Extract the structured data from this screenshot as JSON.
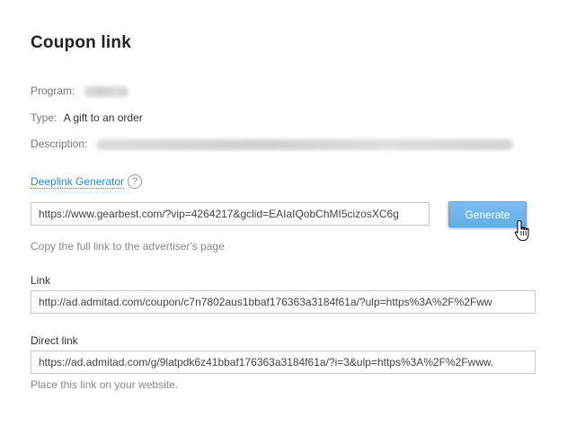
{
  "title": "Coupon link",
  "info": {
    "program_label": "Program:",
    "type_label": "Type:",
    "type_value": "A gift to an order",
    "description_label": "Description:"
  },
  "deeplink": {
    "label": "Deeplink Generator",
    "help": "?",
    "url_value": "https://www.gearbest.com/?vip=4264217&gclid=EAIaIQobChMI5cizosXC6g",
    "button_label": "Generate",
    "hint": "Copy the full link to the advertiser's page"
  },
  "link": {
    "label": "Link",
    "value": "http://ad.admitad.com/coupon/c7n7802aus1bbaf176363a3184f61a/?ulp=https%3A%2F%2Fww"
  },
  "direct_link": {
    "label": "Direct link",
    "value": "https://ad.admitad.com/g/9latpdk6z41bbaf176363a3184f61a/?i=3&ulp=https%3A%2F%2Fwww.",
    "hint": "Place this link on your website."
  }
}
